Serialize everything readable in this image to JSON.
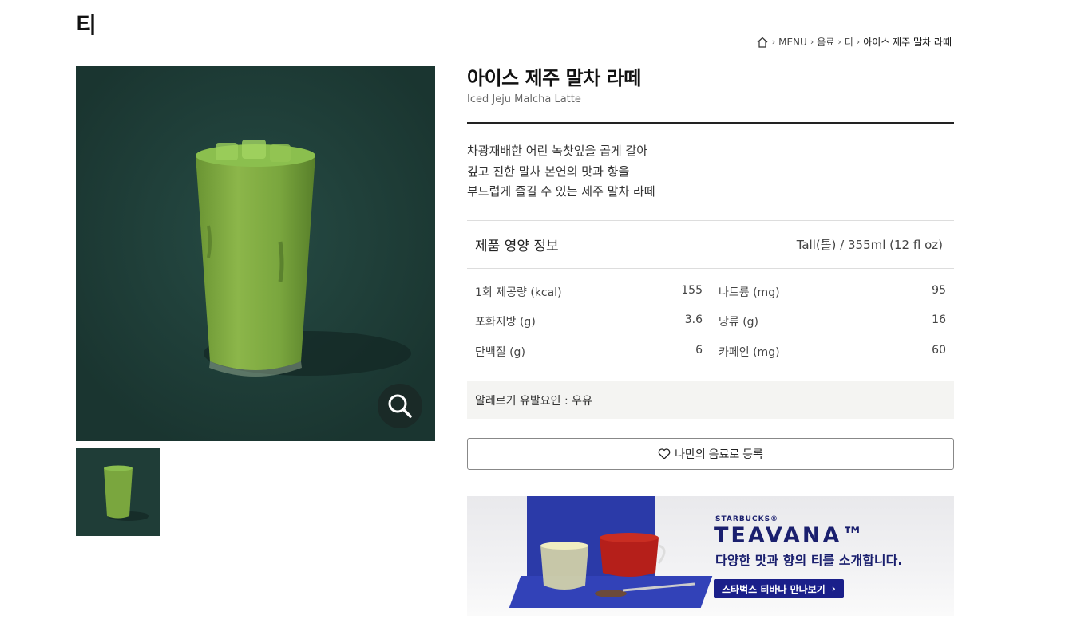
{
  "category_title": "티",
  "breadcrumb": [
    "MENU",
    "음료",
    "티",
    "아이스 제주 말차 라떼"
  ],
  "product": {
    "name_ko": "아이스 제주 말차 라떼",
    "name_en": "Iced Jeju Malcha Latte",
    "description": [
      "차광재배한 어린 녹찻잎을 곱게 갈아",
      "깊고 진한 말차 본연의 맛과 향을",
      "부드럽게 즐길 수 있는 제주 말차 라떼"
    ]
  },
  "nutrition": {
    "title": "제품 영양 정보",
    "size": "Tall(톨) / 355ml (12 fl oz)",
    "left": [
      {
        "label": "1회 제공량 (kcal)",
        "value": "155"
      },
      {
        "label": "포화지방 (g)",
        "value": "3.6"
      },
      {
        "label": "단백질 (g)",
        "value": "6"
      }
    ],
    "right": [
      {
        "label": "나트륨 (mg)",
        "value": "95"
      },
      {
        "label": "당류 (g)",
        "value": "16"
      },
      {
        "label": "카페인 (mg)",
        "value": "60"
      }
    ]
  },
  "allergy": "알레르기 유발요인 : 우유",
  "favorite_button": "나만의 음료로 등록",
  "banner": {
    "brand": "STARBUCKS®",
    "logo": "TEAVANA™",
    "copy": "다양한 맛과 향의 티를 소개합니다.",
    "cta": "스타벅스 티바나 만나보기"
  },
  "colors": {
    "image_bg": "#1d3b36",
    "drink_green": "#7aa63e",
    "banner_navy": "#1a1f6e"
  }
}
